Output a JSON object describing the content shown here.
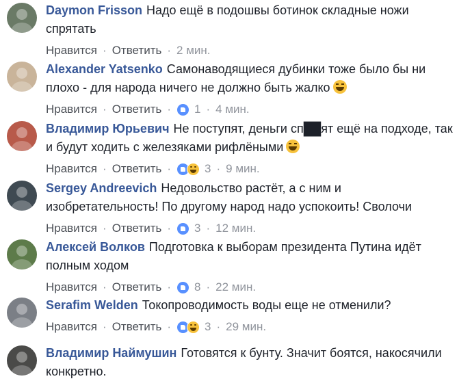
{
  "actions": {
    "like": "Нравится",
    "reply": "Ответить",
    "separator": "·"
  },
  "comments": [
    {
      "author": "Daymon Frisson",
      "text": "Надо ещё в подошвы ботинок складные ножи спрятать",
      "emoji": "",
      "time": "2 мин.",
      "reactions": [],
      "reaction_count": "",
      "avatar_color": "#6a7a66"
    },
    {
      "author": "Alexander Yatsenko",
      "text": "Самонаводящиеся дубинки тоже было бы ни плохо - для народа ничего не должно быть жалко",
      "emoji": "laugh-tears-emoji",
      "time": "4 мин.",
      "reactions": [
        "like"
      ],
      "reaction_count": "1",
      "avatar_color": "#c9b49a"
    },
    {
      "author": "Владимир Юрьевич",
      "text": "Не поступят, деньги сп██ят ещё на подходе, так и будут ходить с железяками рифлёными",
      "emoji": "laugh-tears-emoji",
      "time": "9 мин.",
      "reactions": [
        "like",
        "haha"
      ],
      "reaction_count": "3",
      "avatar_color": "#b85a4a"
    },
    {
      "author": "Sergey Andreevich",
      "text": "Недовольство растёт, а с ним и изобретательность! По другому народ надо успокоить! Сволочи",
      "emoji": "",
      "time": "12 мин.",
      "reactions": [
        "like"
      ],
      "reaction_count": "3",
      "avatar_color": "#3f4a52"
    },
    {
      "author": "Алексей Волков",
      "text": "Подготовка к выборам президента Путина идёт полным ходом",
      "emoji": "",
      "time": "22 мин.",
      "reactions": [
        "like"
      ],
      "reaction_count": "8",
      "avatar_color": "#5d7b4a"
    },
    {
      "author": "Serafim Welden",
      "text": "Токопроводимость воды еще не отменили?",
      "emoji": "",
      "time": "29 мин.",
      "reactions": [
        "like",
        "haha"
      ],
      "reaction_count": "3",
      "avatar_color": "#7b7f86"
    },
    {
      "author": "Владимир Наймушин",
      "text": "Готовятся к бунту. Значит боятся, накосячили конкретно.",
      "emoji": "",
      "time": "",
      "reactions": [],
      "reaction_count": "",
      "avatar_color": "#4a4a48"
    }
  ]
}
